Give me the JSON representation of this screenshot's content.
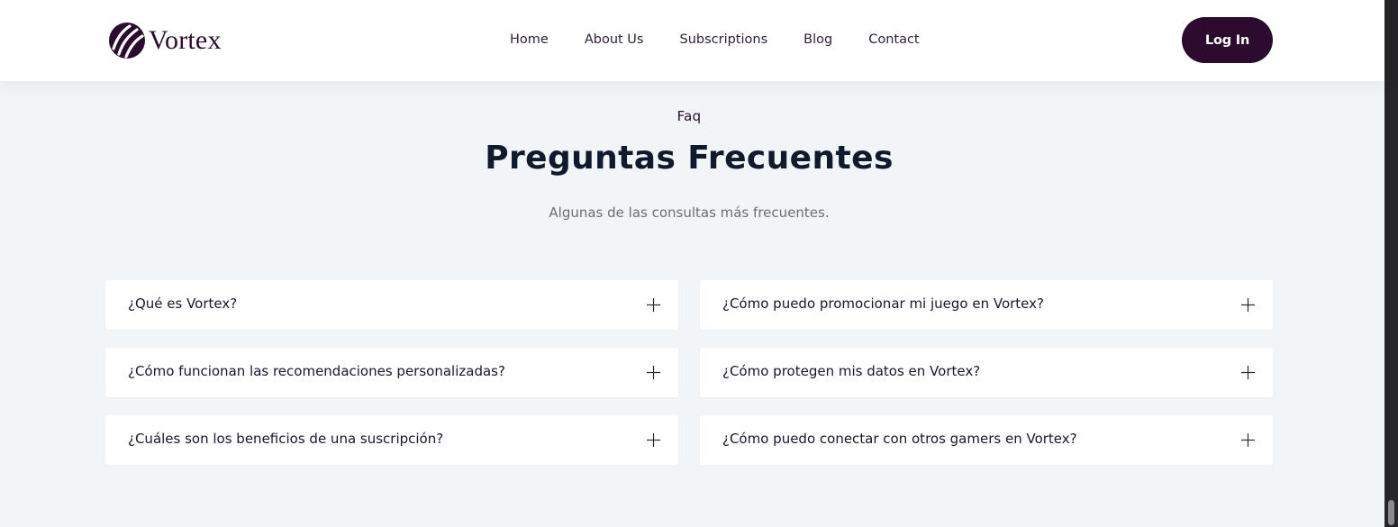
{
  "brand": {
    "name": "Vortex",
    "color": "#2b0b2e"
  },
  "nav": {
    "items": [
      "Home",
      "About Us",
      "Subscriptions",
      "Blog",
      "Contact"
    ]
  },
  "header": {
    "login_label": "Log In"
  },
  "faq": {
    "eyebrow": "Faq",
    "title": "Preguntas Frecuentes",
    "subtitle": "Algunas de las consultas más frecuentes.",
    "left": [
      {
        "question": "¿Qué es Vortex?",
        "icon": "plus-icon"
      },
      {
        "question": "¿Cómo funcionan las recomendaciones personalizadas?",
        "icon": "plus-icon"
      },
      {
        "question": "¿Cuáles son los beneficios de una suscripción?",
        "icon": "plus-icon"
      }
    ],
    "right": [
      {
        "question": "¿Cómo puedo promocionar mi juego en Vortex?",
        "icon": "plus-icon"
      },
      {
        "question": "¿Cómo protegen mis datos en Vortex?",
        "icon": "plus-icon"
      },
      {
        "question": "¿Cómo puedo conectar con otros gamers en Vortex?",
        "icon": "plus-icon"
      }
    ]
  },
  "colors": {
    "background": "#f2f5f8",
    "heading": "#101a2c",
    "muted": "#6c6e73"
  }
}
